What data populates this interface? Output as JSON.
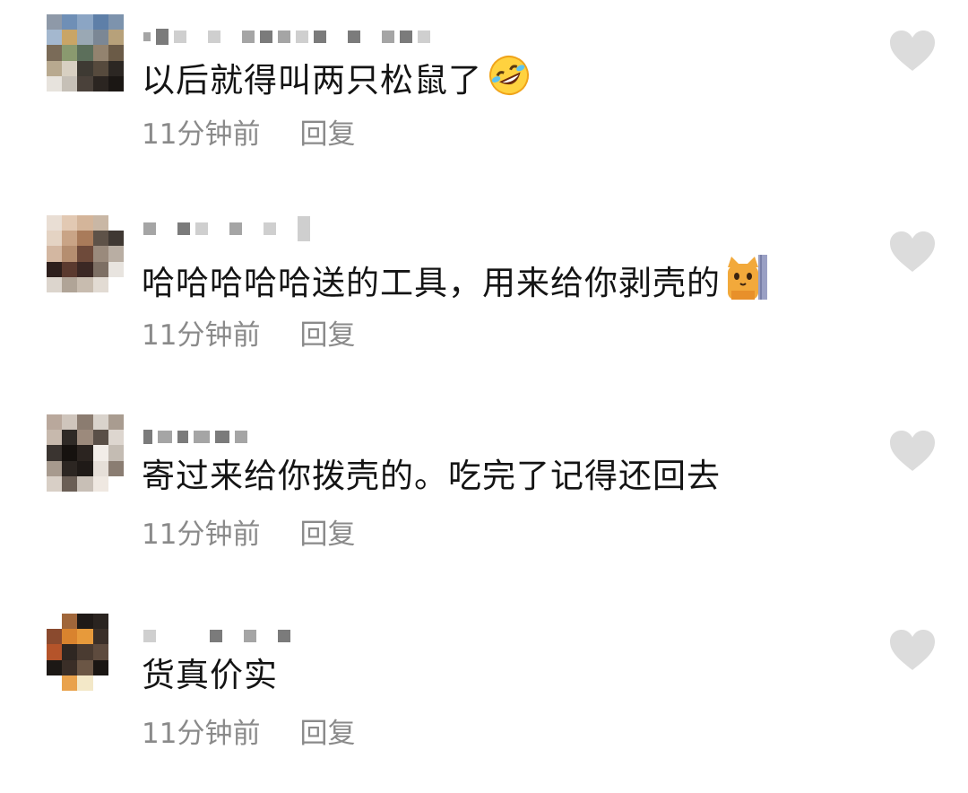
{
  "comments": [
    {
      "text": "以后就得叫两只松鼠了",
      "emoji": "rolling-on-floor-laughing",
      "time": "11分钟前",
      "reply": "回复"
    },
    {
      "text": "哈哈哈哈哈送的工具，用来给你剥壳的",
      "emoji": "peeking-cat",
      "time": "11分钟前",
      "reply": "回复"
    },
    {
      "text": "寄过来给你拨壳的。吃完了记得还回去",
      "emoji": "",
      "time": "11分钟前",
      "reply": "回复"
    },
    {
      "text": "货真价实",
      "emoji": "",
      "time": "11分钟前",
      "reply": "回复"
    }
  ],
  "colors": {
    "text": "#141414",
    "meta": "#8a8a8a",
    "like_icon": "#dcdcdc"
  },
  "icons": {
    "like": "heart-icon"
  }
}
